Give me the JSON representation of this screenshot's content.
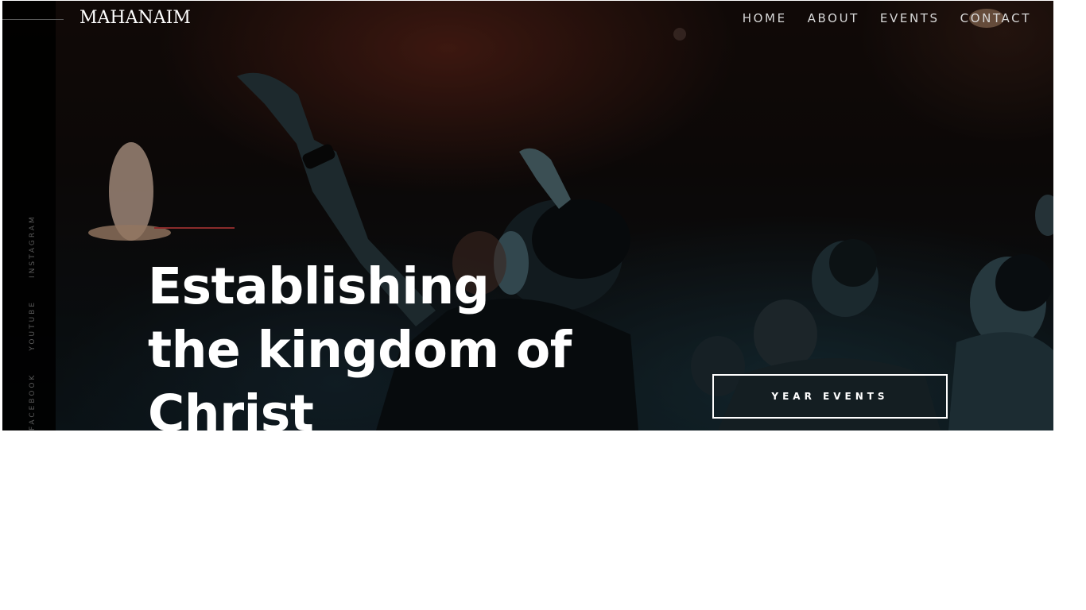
{
  "brand": {
    "logo_text": "MAHANAIM"
  },
  "nav": {
    "items": [
      {
        "label": "HOME"
      },
      {
        "label": "ABOUT"
      },
      {
        "label": "EVENTS"
      },
      {
        "label": "CONTACT"
      }
    ]
  },
  "social": {
    "items": [
      {
        "label": "FACEBOOK"
      },
      {
        "label": "YOUTUBE"
      },
      {
        "label": "INSTAGRAM"
      }
    ]
  },
  "hero": {
    "headline_lines": [
      "Establishing",
      "the kingdom of",
      "Christ"
    ],
    "cta_label": "YEAR EVENTS"
  },
  "colors": {
    "accent": "#8a2b2b",
    "text": "#ffffff",
    "nav_text": "#d8d8d8",
    "strip": "#000000"
  }
}
